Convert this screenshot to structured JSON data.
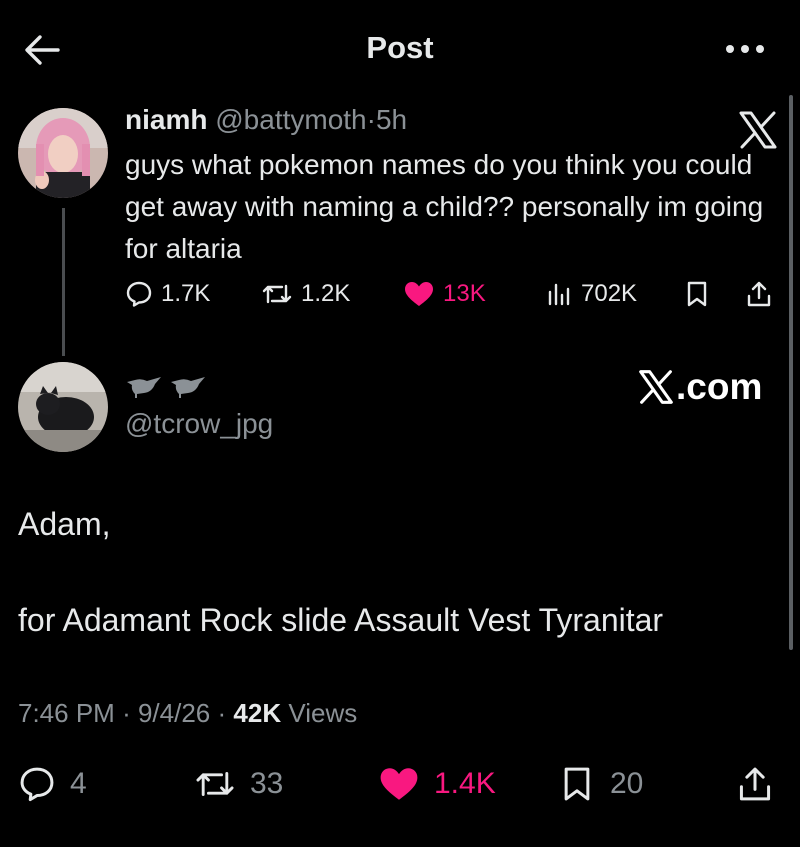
{
  "header": {
    "title": "Post"
  },
  "quoted": {
    "name": "niamh",
    "handle": "@battymoth",
    "sep": "·",
    "age": "5h",
    "text": "guys what pokemon names do you think you could get away with naming a child?? personally im going for altaria",
    "replies": "1.7K",
    "reposts": "1.2K",
    "likes": "13K",
    "views": "702K"
  },
  "post": {
    "handle": "@tcrow_jpg",
    "source_label": ".com",
    "line1": "Adam,",
    "line2": "for Adamant Rock slide Assault Vest Tyranitar",
    "time": "7:46 PM",
    "date": "9/4/26",
    "sep": "·",
    "views_count": "42K",
    "views_label": "Views",
    "replies": "4",
    "reposts": "33",
    "likes": "1.4K",
    "bookmarks": "20"
  },
  "colors": {
    "like": "#f91880",
    "muted": "#8b9196",
    "text": "#e7e9ea",
    "background": "#000000"
  },
  "icons": [
    "back-arrow-icon",
    "more-icon",
    "x-logo-icon",
    "reply-icon",
    "repost-icon",
    "heart-icon",
    "views-icon",
    "bookmark-icon",
    "share-icon"
  ]
}
